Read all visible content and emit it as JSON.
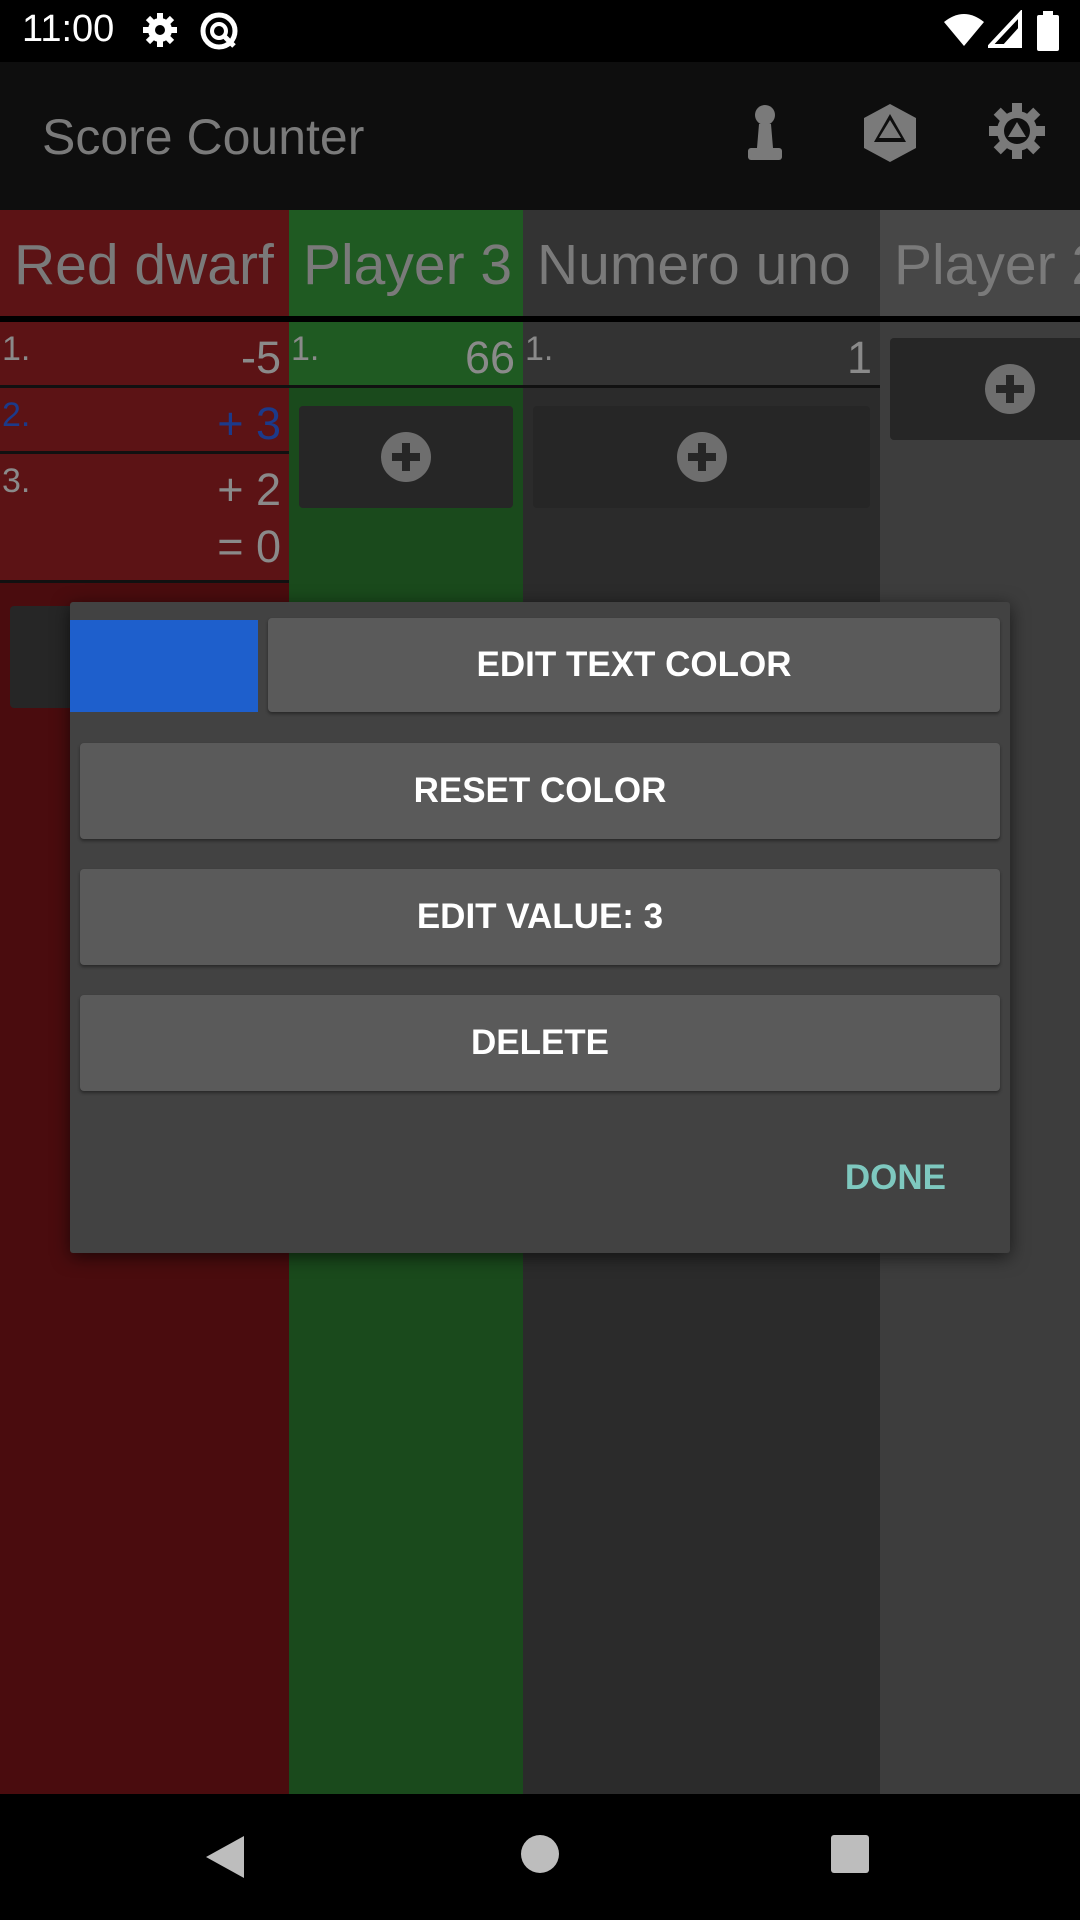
{
  "status": {
    "time": "11:00"
  },
  "appbar": {
    "title": "Score Counter"
  },
  "colors": {
    "red_col": "#4a0c0e",
    "green_col": "#1a4a1c",
    "dark_col": "#2b2b2b",
    "gray_col": "#3d3d3d",
    "dialog_bg": "#424242",
    "swatch": "#1e5fcc",
    "done": "#7ec8bf",
    "blue_value": "#1c3a8a"
  },
  "players": [
    {
      "name": "Red dwarf",
      "rows": [
        {
          "idx": "1.",
          "val": "-5"
        },
        {
          "idx": "2.",
          "val": "+ 3"
        },
        {
          "idx": "3.",
          "val": "+ 2"
        }
      ],
      "total": "= 0"
    },
    {
      "name": "Player 3",
      "rows": [
        {
          "idx": "1.",
          "val": "66"
        }
      ]
    },
    {
      "name": "Numero uno",
      "rows": [
        {
          "idx": "1.",
          "val": "1"
        }
      ]
    },
    {
      "name": "Player 2",
      "rows": []
    }
  ],
  "dialog": {
    "edit_text_color": "EDIT TEXT COLOR",
    "reset_color": "RESET COLOR",
    "edit_value": "EDIT VALUE: 3",
    "delete": "DELETE",
    "done": "DONE"
  },
  "icons": [
    "settings-icon",
    "data-saver-icon",
    "wifi-icon",
    "signal-icon",
    "battery-icon",
    "pawn-icon",
    "dice-icon",
    "gear-icon",
    "back-icon",
    "home-icon",
    "recents-icon",
    "plus-icon"
  ]
}
